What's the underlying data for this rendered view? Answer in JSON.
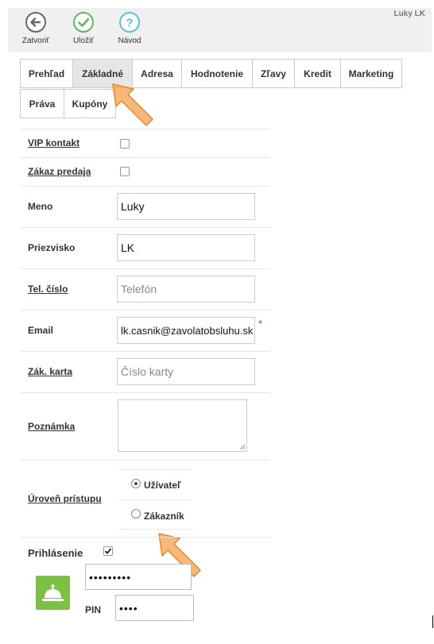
{
  "toolbar": {
    "close_label": "Zatvoriť",
    "save_label": "Uložiť",
    "help_label": "Návod",
    "user_name": "Luky LK"
  },
  "tabs": [
    {
      "label": "Prehľad"
    },
    {
      "label": "Základné"
    },
    {
      "label": "Adresa"
    },
    {
      "label": "Hodnotenie"
    },
    {
      "label": "Zľavy"
    },
    {
      "label": "Kredit"
    },
    {
      "label": "Marketing"
    },
    {
      "label": "Práva"
    },
    {
      "label": "Kupóny"
    }
  ],
  "active_tab": "Základné",
  "form": {
    "vip_label": "VIP kontakt",
    "vip_checked": false,
    "sale_ban_label": "Zákaz predaja",
    "sale_ban_checked": false,
    "first_name_label": "Meno",
    "first_name_value": "Luky",
    "last_name_label": "Priezvisko",
    "last_name_value": "LK",
    "phone_label": "Tel. číslo",
    "phone_placeholder": "Telefón",
    "email_label": "Email",
    "email_value": "lk.casnik@zavolatobsluhu.sk",
    "required_mark": "*",
    "card_label": "Zák. karta",
    "card_placeholder": "Číslo karty",
    "note_label": "Poznámka",
    "access_label": "Úroveň prístupu",
    "access_options": [
      {
        "label": "Užívateľ",
        "selected": true
      },
      {
        "label": "Zákazník",
        "selected": false
      }
    ],
    "login_label": "Prihlásenie",
    "login_checked": true,
    "password_value": "•••••••••",
    "pin_label": "PIN",
    "pin_value": "••••"
  },
  "colors": {
    "accent_green": "#5cb85c",
    "accent_blue": "#5bc0de",
    "bell_green": "#7cc242",
    "arrow_orange": "#f5a04a"
  }
}
